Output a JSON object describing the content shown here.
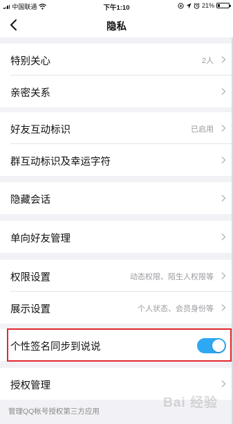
{
  "status_bar": {
    "carrier": "中国联通",
    "time": "下午1:10",
    "battery": "21%",
    "battery_level": 0.21
  },
  "nav": {
    "title": "隐私"
  },
  "groups": [
    {
      "rows": [
        {
          "label": "特别关心",
          "value": "2人"
        },
        {
          "label": "亲密关系",
          "value": ""
        }
      ]
    },
    {
      "rows": [
        {
          "label": "好友互动标识",
          "value": "已启用"
        },
        {
          "label": "群互动标识及幸运字符",
          "value": ""
        }
      ]
    },
    {
      "rows": [
        {
          "label": "隐藏会话",
          "value": ""
        }
      ]
    },
    {
      "rows": [
        {
          "label": "单向好友管理",
          "value": ""
        }
      ]
    },
    {
      "rows": [
        {
          "label": "权限设置",
          "value": "动态权限、陌生人权限等"
        },
        {
          "label": "展示设置",
          "value": "个人状态、会员身份等"
        }
      ]
    },
    {
      "rows": [
        {
          "label": "个性签名同步到说说",
          "toggle_on": true
        }
      ]
    },
    {
      "rows": [
        {
          "label": "授权管理",
          "value": ""
        }
      ]
    }
  ],
  "footer_note": "管理QQ帐号授权第三方应用",
  "watermark": "Bai 经验",
  "colors": {
    "accent": "#2fa8f3",
    "highlight": "#e3262b",
    "background": "#f2f2f6"
  }
}
